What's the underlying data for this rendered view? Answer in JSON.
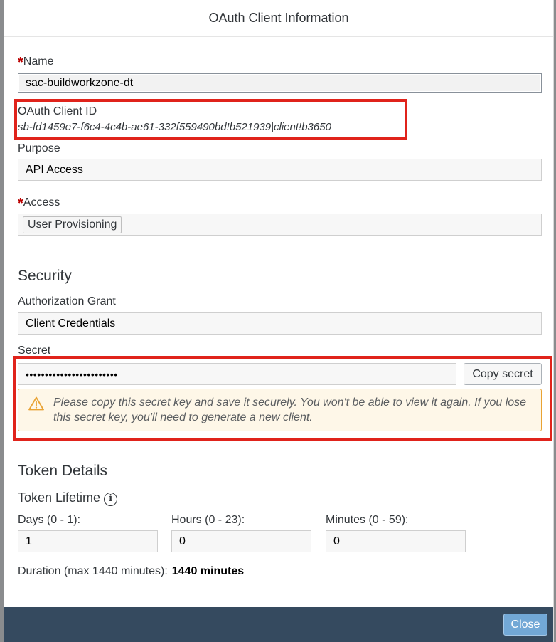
{
  "dialog": {
    "title": "OAuth Client Information"
  },
  "name": {
    "label": "Name",
    "required_mark": "*",
    "value": "sac-buildworkzone-dt"
  },
  "client_id": {
    "label": "OAuth Client ID",
    "value": "sb-fd1459e7-f6c4-4c4b-ae61-332f559490bd!b521939|client!b3650"
  },
  "purpose": {
    "label": "Purpose",
    "value": "API Access"
  },
  "access": {
    "label": "Access",
    "required_mark": "*",
    "token": "User Provisioning"
  },
  "security": {
    "title": "Security",
    "grant_label": "Authorization Grant",
    "grant_value": "Client Credentials",
    "secret_label": "Secret",
    "secret_value": "••••••••••••••••••••••••",
    "copy_label": "Copy secret",
    "warning": "Please copy this secret key and save it securely. You won't be able to view it again. If you lose this secret key, you'll need to generate a new client."
  },
  "token": {
    "title": "Token Details",
    "lifetime_label": "Token Lifetime",
    "info_glyph": "i",
    "days_label": "Days (0 - 1):",
    "days_value": "1",
    "hours_label": "Hours (0 - 23):",
    "hours_value": "0",
    "minutes_label": "Minutes (0 - 59):",
    "minutes_value": "0",
    "duration_label": "Duration (max 1440 minutes):",
    "duration_value": "1440 minutes"
  },
  "footer": {
    "close_label": "Close"
  },
  "colors": {
    "highlight": "#e0231b",
    "footer_bg": "#354a5f",
    "close_button": "#72a8d6",
    "warning_border": "#e9a334"
  }
}
